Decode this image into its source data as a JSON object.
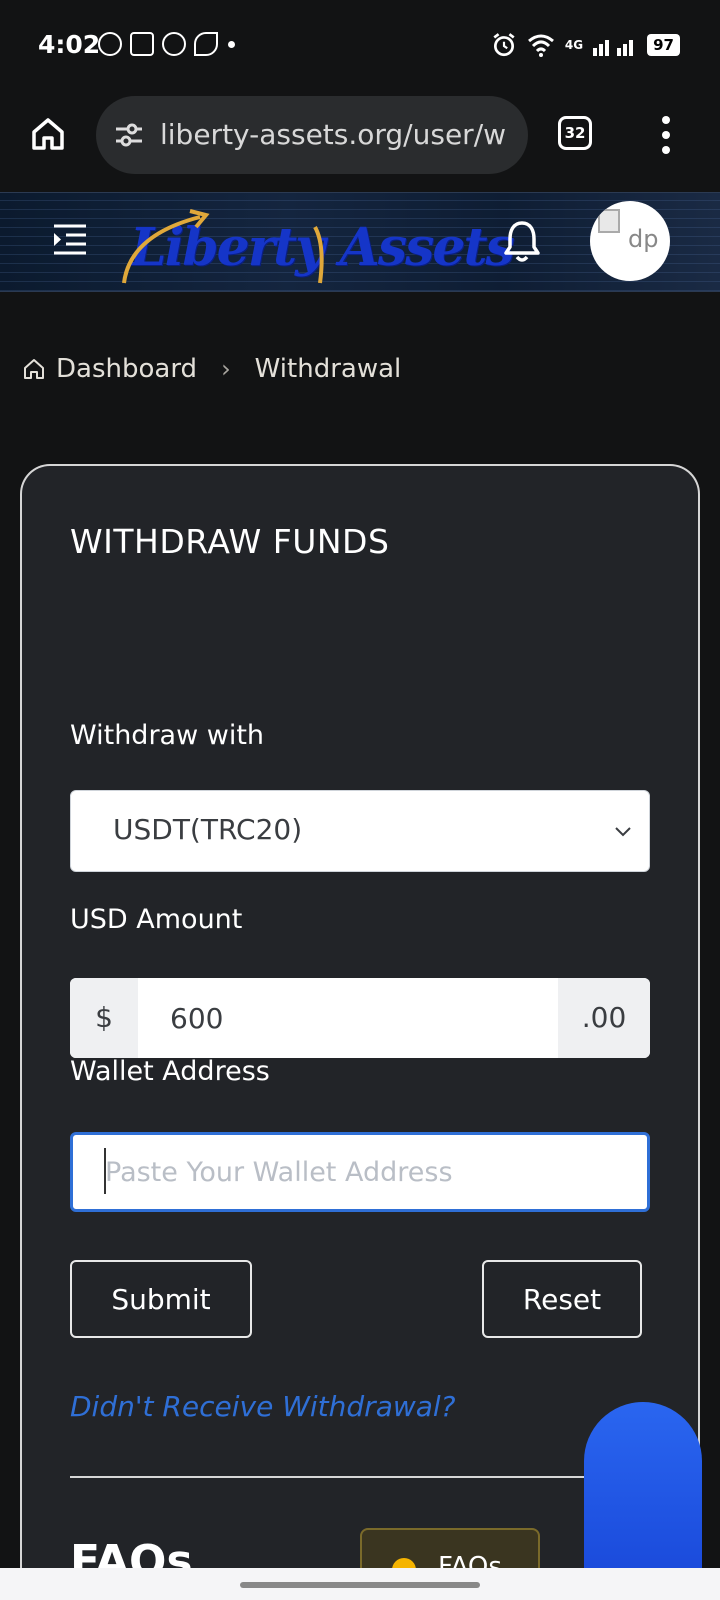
{
  "status_bar": {
    "time": "4:02",
    "network": "4G",
    "battery": "97"
  },
  "browser": {
    "url": "liberty-assets.org/user/w",
    "tab_count": "32"
  },
  "header": {
    "logo_text": "Liberty Assets",
    "avatar_alt": "dp"
  },
  "breadcrumb": {
    "home": "Dashboard",
    "separator": "›",
    "current": "Withdrawal"
  },
  "form": {
    "title": "WITHDRAW FUNDS",
    "withdraw_with_label": "Withdraw with",
    "withdraw_method": "USDT(TRC20)",
    "amount_label": "USD Amount",
    "currency_symbol": "$",
    "amount_value": "600",
    "amount_suffix": ".00",
    "wallet_label": "Wallet Address",
    "wallet_placeholder": "Paste Your Wallet Address",
    "wallet_value": "",
    "submit_label": "Submit",
    "reset_label": "Reset",
    "help_link": "Didn't Receive Withdrawal?"
  },
  "faq": {
    "title": "FAQs",
    "button_label": "FAQs"
  },
  "colors": {
    "accent": "#2f6fd6",
    "card_bg": "#222428",
    "page_bg": "#121314",
    "logo_blue": "#1535c8",
    "float_button": "#1846d8"
  }
}
